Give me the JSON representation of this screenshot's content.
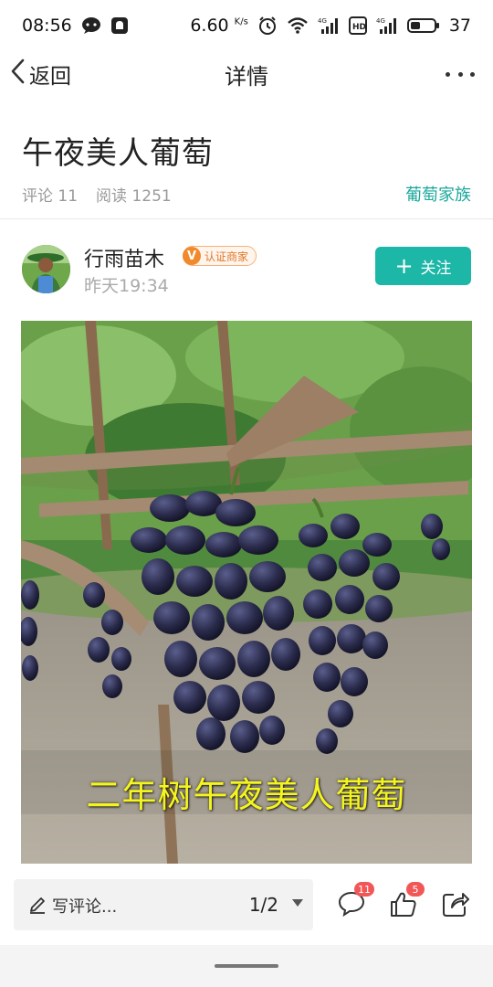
{
  "status_bar": {
    "time": "08:56",
    "net_speed": "6.60",
    "net_speed_unit": "K/s",
    "battery": "37",
    "icons": [
      "chat-bubble-icon",
      "notification-bell-icon",
      "alarm-icon",
      "wifi-icon",
      "signal-4g-icon",
      "hd-icon",
      "signal-4g-icon",
      "battery-icon"
    ]
  },
  "nav": {
    "back_label": "返回",
    "title": "详情",
    "more_icon": "more-dots-icon"
  },
  "article": {
    "title": "午夜美人葡萄",
    "comments_label": "评论 11",
    "reads_label": "阅读 1251",
    "topic": "葡萄家族"
  },
  "author": {
    "name": "行雨苗木",
    "verified_label": "认证商家",
    "verified_mark": "V",
    "time": "昨天19:34",
    "follow_label": "关注"
  },
  "media": {
    "caption": "二年树午夜美人葡萄"
  },
  "bottom_bar": {
    "comment_placeholder": "写评论...",
    "page_indicator": "1/2",
    "comment_count": "11",
    "like_count": "5"
  },
  "colors": {
    "accent": "#1db7a8",
    "topic": "#1aa89a",
    "badge": "#f25757",
    "verify": "#f08a2c",
    "caption": "#f5f51e"
  }
}
